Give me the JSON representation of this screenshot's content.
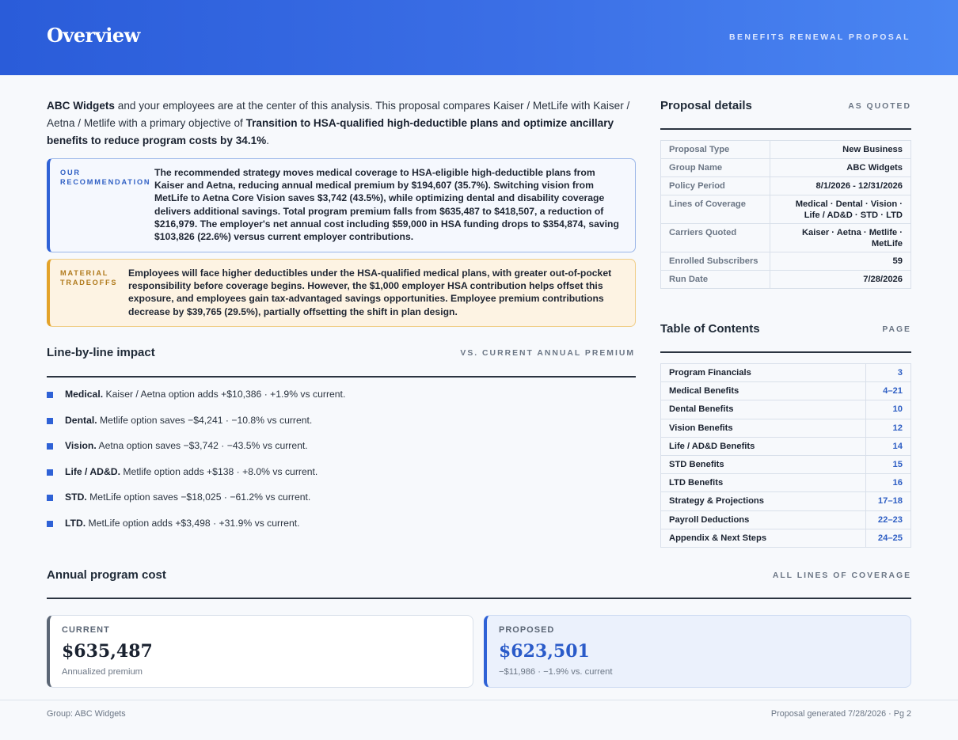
{
  "header": {
    "title": "Overview",
    "subtitle": "BENEFITS RENEWAL PROPOSAL"
  },
  "intro": {
    "company": "ABC Widgets",
    "text1": " and your employees are at the center of this analysis. This proposal compares Kaiser / MetLife with Kaiser / Aetna / Metlife with a primary objective of ",
    "objective": "Transition to HSA-qualified high-deductible plans and optimize ancillary benefits to reduce program costs by 34.1%",
    "text2": "."
  },
  "recommendation": {
    "label": "OUR RECOMMENDATION",
    "text": "The recommended strategy moves medical coverage to HSA-eligible high-deductible plans from Kaiser and Aetna, reducing annual medical premium by $194,607 (35.7%). Switching vision from MetLife to Aetna Core Vision saves $3,742 (43.5%), while optimizing dental and disability coverage delivers additional savings. Total program premium falls from $635,487 to $418,507, a reduction of $216,979. The employer's net annual cost including $59,000 in HSA funding drops to $354,874, saving $103,826 (22.6%) versus current employer contributions."
  },
  "tradeoffs": {
    "label": "MATERIAL TRADEOFFS",
    "text": "Employees will face higher deductibles under the HSA-qualified medical plans, with greater out-of-pocket responsibility before coverage begins. However, the $1,000 employer HSA contribution helps offset this exposure, and employees gain tax-advantaged savings opportunities. Employee premium contributions decrease by $39,765 (29.5%), partially offsetting the shift in plan design."
  },
  "impact": {
    "title": "Line-by-line impact",
    "tag": "VS. CURRENT ANNUAL PREMIUM",
    "items": [
      {
        "line": "Medical.",
        "text": " Kaiser / Aetna option adds +$10,386 · +1.9% vs current."
      },
      {
        "line": "Dental.",
        "text": " Metlife option saves −$4,241 · −10.8% vs current."
      },
      {
        "line": "Vision.",
        "text": " Aetna option saves −$3,742 · −43.5% vs current."
      },
      {
        "line": "Life / AD&D.",
        "text": " Metlife option adds +$138 · +8.0% vs current."
      },
      {
        "line": "STD.",
        "text": " MetLife option saves −$18,025 · −61.2% vs current."
      },
      {
        "line": "LTD.",
        "text": " MetLife option adds +$3,498 · +31.9% vs current."
      }
    ]
  },
  "details": {
    "title": "Proposal details",
    "tag": "AS QUOTED",
    "rows": [
      {
        "k": "Proposal Type",
        "v": "New Business"
      },
      {
        "k": "Group Name",
        "v": "ABC Widgets"
      },
      {
        "k": "Policy Period",
        "v": "8/1/2026 - 12/31/2026"
      },
      {
        "k": "Lines of Coverage",
        "v": "Medical · Dental · Vision · Life / AD&D · STD · LTD"
      },
      {
        "k": "Carriers Quoted",
        "v": "Kaiser · Aetna · Metlife · MetLife"
      },
      {
        "k": "Enrolled Subscribers",
        "v": "59"
      },
      {
        "k": "Run Date",
        "v": "7/28/2026"
      }
    ]
  },
  "toc": {
    "title": "Table of Contents",
    "tag": "PAGE",
    "rows": [
      {
        "k": "Program Financials",
        "v": "3"
      },
      {
        "k": "Medical Benefits",
        "v": "4–21"
      },
      {
        "k": "Dental Benefits",
        "v": "10"
      },
      {
        "k": "Vision Benefits",
        "v": "12"
      },
      {
        "k": "Life / AD&D Benefits",
        "v": "14"
      },
      {
        "k": "STD Benefits",
        "v": "15"
      },
      {
        "k": "LTD Benefits",
        "v": "16"
      },
      {
        "k": "Strategy & Projections",
        "v": "17–18"
      },
      {
        "k": "Payroll Deductions",
        "v": "22–23"
      },
      {
        "k": "Appendix & Next Steps",
        "v": "24–25"
      }
    ]
  },
  "cost": {
    "title": "Annual program cost",
    "tag": "ALL LINES OF COVERAGE",
    "current": {
      "label": "CURRENT",
      "value": "$635,487",
      "note": "Annualized premium"
    },
    "proposed": {
      "label": "PROPOSED",
      "value": "$623,501",
      "note": "−$11,986 · −1.9% vs. current"
    }
  },
  "footer": {
    "left": "Group: ABC Widgets",
    "right": "Proposal generated 7/28/2026 · Pg 2"
  },
  "colors": {
    "accent": "#2f62d6",
    "tradeoff": "#e3a32a"
  }
}
